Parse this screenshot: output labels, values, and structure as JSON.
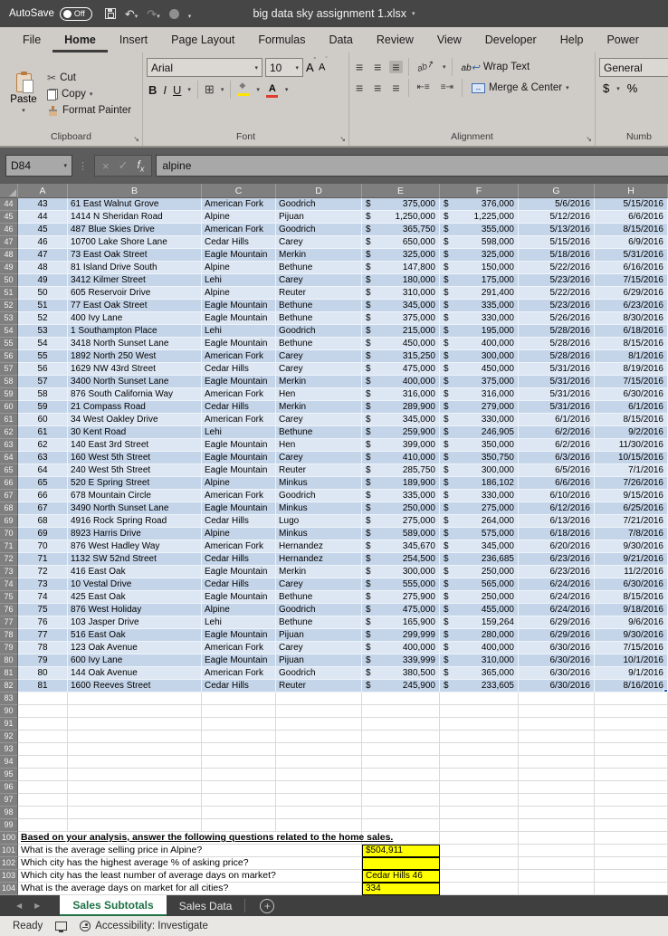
{
  "colors": {
    "accent_green": "#1e7145",
    "highlight_yellow": "#ffff00",
    "band_dark": "#c5d5e9",
    "band_light": "#dde7f3"
  },
  "title_bar": {
    "autosave_label": "AutoSave",
    "autosave_state": "Off",
    "document_title": "big data sky assignment 1.xlsx"
  },
  "menu": {
    "tabs": [
      "File",
      "Home",
      "Insert",
      "Page Layout",
      "Formulas",
      "Data",
      "Review",
      "View",
      "Developer",
      "Help",
      "Power"
    ],
    "active_tab": "Home"
  },
  "ribbon": {
    "clipboard": {
      "group_label": "Clipboard",
      "paste": "Paste",
      "cut": "Cut",
      "copy": "Copy",
      "format_painter": "Format Painter"
    },
    "font": {
      "group_label": "Font",
      "font_name": "Arial",
      "font_size": "10",
      "bold": "B",
      "italic": "I",
      "underline": "U"
    },
    "alignment": {
      "group_label": "Alignment",
      "wrap_text": "Wrap Text",
      "merge_center": "Merge & Center"
    },
    "number": {
      "group_label": "Numb",
      "format": "General",
      "currency": "$",
      "percent": "%"
    }
  },
  "formula_bar": {
    "cell_reference": "D84",
    "formula_text": "alpine"
  },
  "sheet": {
    "columns": [
      "A",
      "B",
      "C",
      "D",
      "E",
      "F",
      "G",
      "H"
    ],
    "data_rows": [
      {
        "n": 44,
        "c": [
          "43",
          "61 East Walnut Grove",
          "American Fork",
          "Goodrich",
          "375,000",
          "376,000",
          "5/6/2016",
          "5/15/2016"
        ]
      },
      {
        "n": 45,
        "c": [
          "44",
          "1414 N Sheridan Road",
          "Alpine",
          "Pijuan",
          "1,250,000",
          "1,225,000",
          "5/12/2016",
          "6/6/2016"
        ]
      },
      {
        "n": 46,
        "c": [
          "45",
          "487 Blue Skies Drive",
          "American Fork",
          "Goodrich",
          "365,750",
          "355,000",
          "5/13/2016",
          "8/15/2016"
        ]
      },
      {
        "n": 47,
        "c": [
          "46",
          "10700 Lake Shore Lane",
          "Cedar Hills",
          "Carey",
          "650,000",
          "598,000",
          "5/15/2016",
          "6/9/2016"
        ]
      },
      {
        "n": 48,
        "c": [
          "47",
          "73 East Oak Street",
          "Eagle Mountain",
          "Merkin",
          "325,000",
          "325,000",
          "5/18/2016",
          "5/31/2016"
        ]
      },
      {
        "n": 49,
        "c": [
          "48",
          "81 Island Drive South",
          "Alpine",
          "Bethune",
          "147,800",
          "150,000",
          "5/22/2016",
          "6/16/2016"
        ]
      },
      {
        "n": 50,
        "c": [
          "49",
          "3412 Kilmer Street",
          "Lehi",
          "Carey",
          "180,000",
          "175,000",
          "5/23/2016",
          "7/15/2016"
        ]
      },
      {
        "n": 51,
        "c": [
          "50",
          "605 Reservoir Drive",
          "Alpine",
          "Reuter",
          "310,000",
          "291,400",
          "5/22/2016",
          "6/29/2016"
        ]
      },
      {
        "n": 52,
        "c": [
          "51",
          "77 East Oak Street",
          "Eagle Mountain",
          "Bethune",
          "345,000",
          "335,000",
          "5/23/2016",
          "6/23/2016"
        ]
      },
      {
        "n": 53,
        "c": [
          "52",
          "400 Ivy Lane",
          "Eagle Mountain",
          "Bethune",
          "375,000",
          "330,000",
          "5/26/2016",
          "8/30/2016"
        ]
      },
      {
        "n": 54,
        "c": [
          "53",
          "1 Southampton Place",
          "Lehi",
          "Goodrich",
          "215,000",
          "195,000",
          "5/28/2016",
          "6/18/2016"
        ]
      },
      {
        "n": 55,
        "c": [
          "54",
          "3418 North Sunset Lane",
          "Eagle Mountain",
          "Bethune",
          "450,000",
          "400,000",
          "5/28/2016",
          "8/15/2016"
        ]
      },
      {
        "n": 56,
        "c": [
          "55",
          "1892 North 250 West",
          "American Fork",
          "Carey",
          "315,250",
          "300,000",
          "5/28/2016",
          "8/1/2016"
        ]
      },
      {
        "n": 57,
        "c": [
          "56",
          "1629 NW 43rd Street",
          "Cedar Hills",
          "Carey",
          "475,000",
          "450,000",
          "5/31/2016",
          "8/19/2016"
        ]
      },
      {
        "n": 58,
        "c": [
          "57",
          "3400 North Sunset Lane",
          "Eagle Mountain",
          "Merkin",
          "400,000",
          "375,000",
          "5/31/2016",
          "7/15/2016"
        ]
      },
      {
        "n": 59,
        "c": [
          "58",
          "876 South California Way",
          "American Fork",
          "Hen",
          "316,000",
          "316,000",
          "5/31/2016",
          "6/30/2016"
        ]
      },
      {
        "n": 60,
        "c": [
          "59",
          "21 Compass Road",
          "Cedar Hills",
          "Merkin",
          "289,900",
          "279,000",
          "5/31/2016",
          "6/1/2016"
        ]
      },
      {
        "n": 61,
        "c": [
          "60",
          "34 West Oakley Drive",
          "American Fork",
          "Carey",
          "345,000",
          "330,000",
          "6/1/2016",
          "8/15/2016"
        ]
      },
      {
        "n": 62,
        "c": [
          "61",
          "30 Kent Road",
          "Lehi",
          "Bethune",
          "259,900",
          "246,905",
          "6/2/2016",
          "9/2/2016"
        ]
      },
      {
        "n": 63,
        "c": [
          "62",
          "140 East 3rd Street",
          "Eagle Mountain",
          "Hen",
          "399,000",
          "350,000",
          "6/2/2016",
          "11/30/2016"
        ]
      },
      {
        "n": 64,
        "c": [
          "63",
          "160 West 5th Street",
          "Eagle Mountain",
          "Carey",
          "410,000",
          "350,750",
          "6/3/2016",
          "10/15/2016"
        ]
      },
      {
        "n": 65,
        "c": [
          "64",
          "240 West 5th Street",
          "Eagle Mountain",
          "Reuter",
          "285,750",
          "300,000",
          "6/5/2016",
          "7/1/2016"
        ]
      },
      {
        "n": 66,
        "c": [
          "65",
          "520 E Spring Street",
          "Alpine",
          "Minkus",
          "189,900",
          "186,102",
          "6/6/2016",
          "7/26/2016"
        ]
      },
      {
        "n": 67,
        "c": [
          "66",
          "678 Mountain Circle",
          "American Fork",
          "Goodrich",
          "335,000",
          "330,000",
          "6/10/2016",
          "9/15/2016"
        ]
      },
      {
        "n": 68,
        "c": [
          "67",
          "3490 North Sunset Lane",
          "Eagle Mountain",
          "Minkus",
          "250,000",
          "275,000",
          "6/12/2016",
          "6/25/2016"
        ]
      },
      {
        "n": 69,
        "c": [
          "68",
          "4916 Rock Spring Road",
          "Cedar Hills",
          "Lugo",
          "275,000",
          "264,000",
          "6/13/2016",
          "7/21/2016"
        ]
      },
      {
        "n": 70,
        "c": [
          "69",
          "8923 Harris Drive",
          "Alpine",
          "Minkus",
          "589,000",
          "575,000",
          "6/18/2016",
          "7/8/2016"
        ]
      },
      {
        "n": 71,
        "c": [
          "70",
          "876 West Hadley Way",
          "American Fork",
          "Hernandez",
          "345,670",
          "345,000",
          "6/20/2016",
          "9/30/2016"
        ]
      },
      {
        "n": 72,
        "c": [
          "71",
          "1132 SW 52nd Street",
          "Cedar Hills",
          "Hernandez",
          "254,500",
          "236,685",
          "6/23/2016",
          "9/21/2016"
        ]
      },
      {
        "n": 73,
        "c": [
          "72",
          "416 East Oak",
          "Eagle Mountain",
          "Merkin",
          "300,000",
          "250,000",
          "6/23/2016",
          "11/2/2016"
        ]
      },
      {
        "n": 74,
        "c": [
          "73",
          "10 Vestal Drive",
          "Cedar Hills",
          "Carey",
          "555,000",
          "565,000",
          "6/24/2016",
          "6/30/2016"
        ]
      },
      {
        "n": 75,
        "c": [
          "74",
          "425 East Oak",
          "Eagle Mountain",
          "Bethune",
          "275,900",
          "250,000",
          "6/24/2016",
          "8/15/2016"
        ]
      },
      {
        "n": 76,
        "c": [
          "75",
          "876 West Holiday",
          "Alpine",
          "Goodrich",
          "475,000",
          "455,000",
          "6/24/2016",
          "9/18/2016"
        ]
      },
      {
        "n": 77,
        "c": [
          "76",
          "103 Jasper Drive",
          "Lehi",
          "Bethune",
          "165,900",
          "159,264",
          "6/29/2016",
          "9/6/2016"
        ]
      },
      {
        "n": 78,
        "c": [
          "77",
          "516 East Oak",
          "Eagle Mountain",
          "Pijuan",
          "299,999",
          "280,000",
          "6/29/2016",
          "9/30/2016"
        ]
      },
      {
        "n": 79,
        "c": [
          "78",
          "123 Oak Avenue",
          "American Fork",
          "Carey",
          "400,000",
          "400,000",
          "6/30/2016",
          "7/15/2016"
        ]
      },
      {
        "n": 80,
        "c": [
          "79",
          "600 Ivy Lane",
          "Eagle Mountain",
          "Pijuan",
          "339,999",
          "310,000",
          "6/30/2016",
          "10/1/2016"
        ]
      },
      {
        "n": 81,
        "c": [
          "80",
          "144 Oak Avenue",
          "American Fork",
          "Goodrich",
          "380,500",
          "365,000",
          "6/30/2016",
          "9/1/2016"
        ]
      },
      {
        "n": 82,
        "c": [
          "81",
          "1600 Reeves Street",
          "Cedar Hills",
          "Reuter",
          "245,900",
          "233,605",
          "6/30/2016",
          "8/16/2016"
        ]
      }
    ],
    "empty_row_numbers": [
      83,
      90,
      91,
      92,
      93,
      94,
      95,
      96,
      97,
      98,
      99
    ],
    "question_header": {
      "n": 100,
      "text": "Based on your analysis, answer the following questions related to the home sales."
    },
    "questions": [
      {
        "n": 101,
        "text": "What is the average selling price in Alpine?",
        "answer": "$504,911"
      },
      {
        "n": 102,
        "text": "Which city has the highest average % of asking price?",
        "answer": ""
      },
      {
        "n": 103,
        "text": "Which city has the least number of average days on market?",
        "answer": "Cedar Hills 46"
      },
      {
        "n": 104,
        "text": "What is the average days on market for all cities?",
        "answer": "334"
      }
    ]
  },
  "sheet_tabs": {
    "tabs": [
      "Sales Subtotals",
      "Sales Data"
    ],
    "active": "Sales Subtotals"
  },
  "status_bar": {
    "mode": "Ready",
    "accessibility": "Accessibility: Investigate"
  }
}
